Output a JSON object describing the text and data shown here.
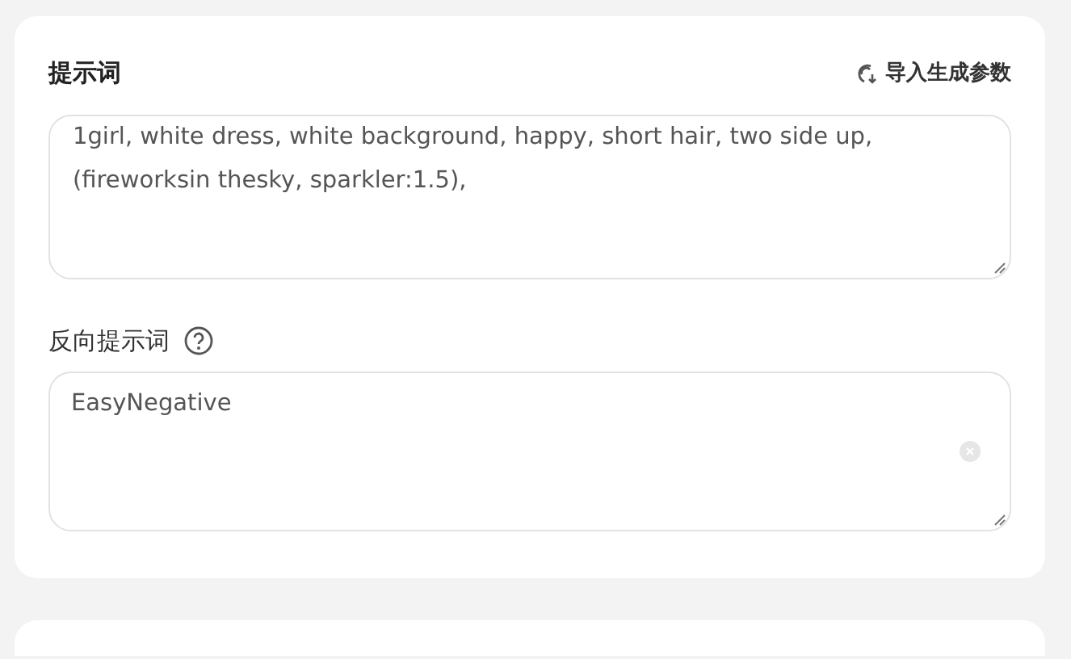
{
  "prompt": {
    "title": "提示词",
    "import_label": "导入生成参数",
    "value": "1girl, white dress, white background, happy,  short hair, two side up,  (fireworksin thesky, sparkler:1.5),"
  },
  "negative_prompt": {
    "title": "反向提示词",
    "value": "EasyNegative"
  }
}
